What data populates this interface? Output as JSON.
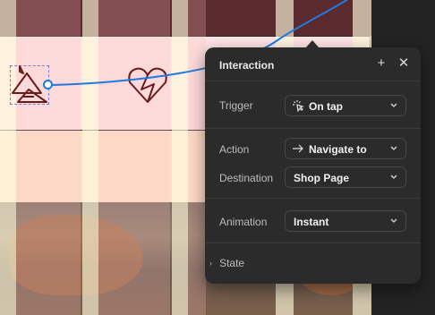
{
  "colors": {
    "panel_bg": "#2b2b2b",
    "accent_connection": "#1f7ae0",
    "selection_dash": "#6a7fd0",
    "canvas_pink": "#fde3e3",
    "canvas_peach": "#fde0c8"
  },
  "canvas": {
    "icons": [
      "campfire-icon",
      "heart-icon"
    ]
  },
  "panel": {
    "title": "Interaction",
    "add_icon": "plus-icon",
    "close_icon": "close-icon",
    "trigger": {
      "label": "Trigger",
      "value": "On tap",
      "icon": "tap-icon"
    },
    "action": {
      "label": "Action",
      "value": "Navigate to",
      "icon": "arrow-right-icon"
    },
    "destination": {
      "label": "Destination",
      "value": "Shop Page"
    },
    "animation": {
      "label": "Animation",
      "value": "Instant"
    },
    "state": {
      "label": "State"
    }
  }
}
